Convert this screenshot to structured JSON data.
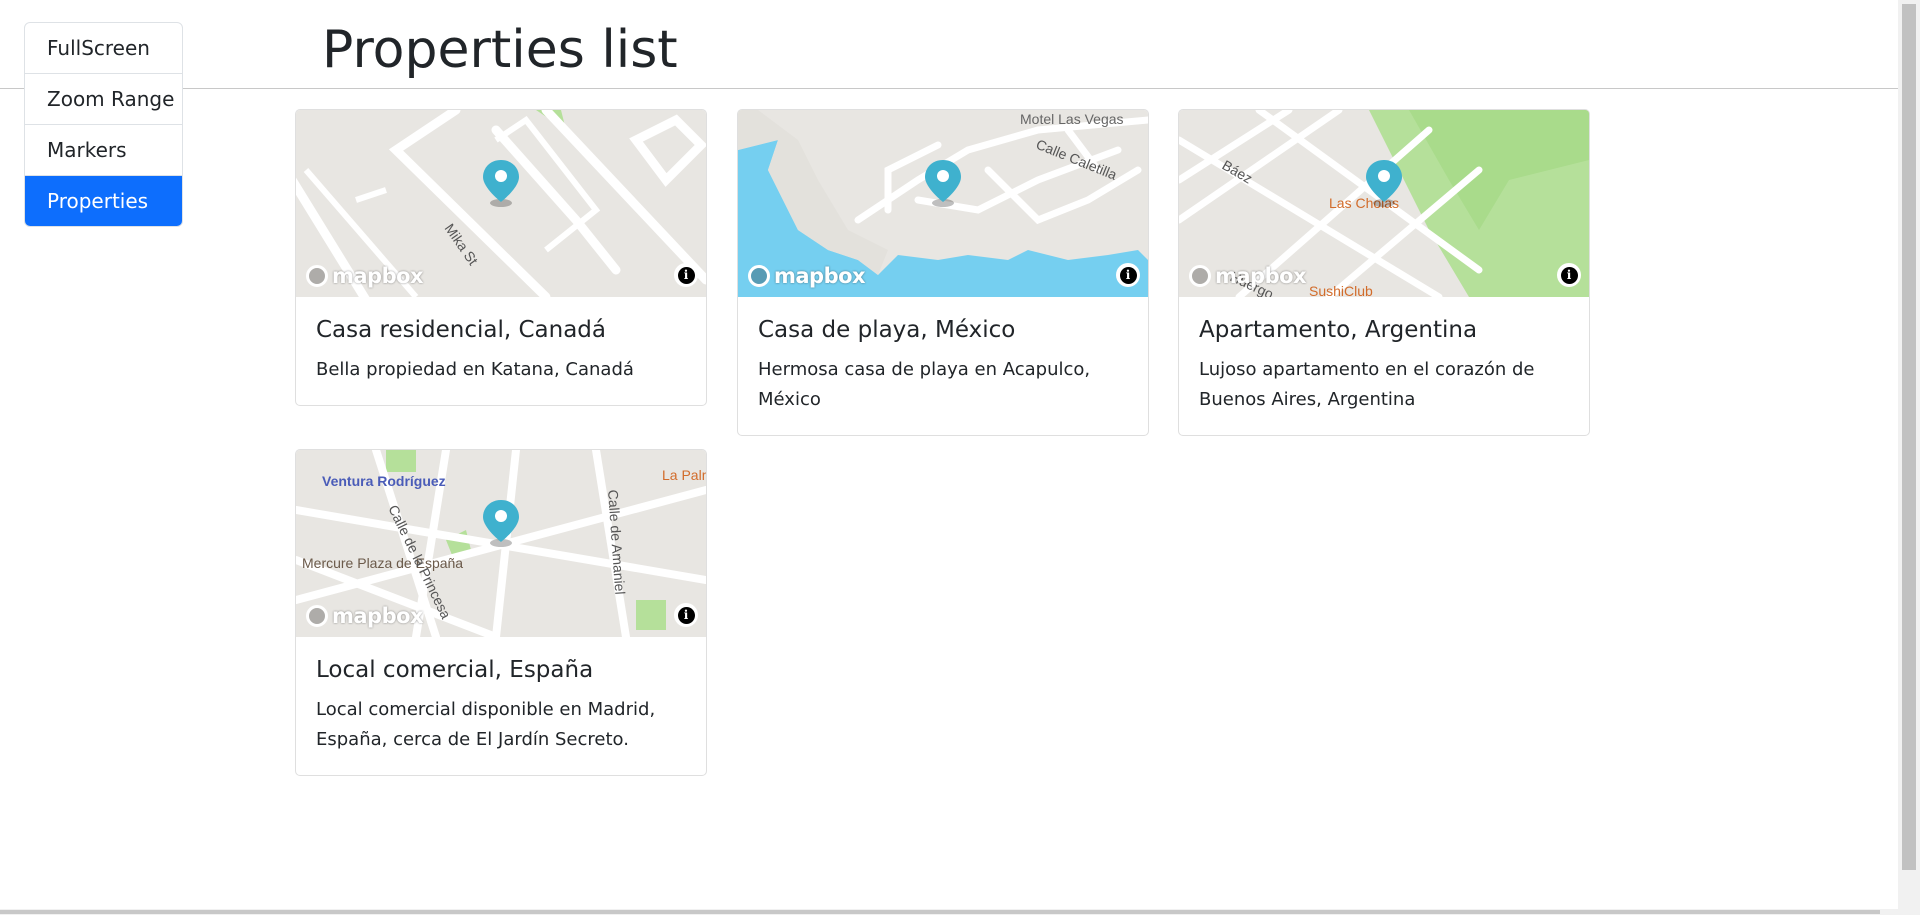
{
  "page": {
    "title": "Properties list"
  },
  "nav": {
    "items": [
      {
        "label": "FullScreen",
        "active": false
      },
      {
        "label": "Zoom Range",
        "active": false
      },
      {
        "label": "Markers",
        "active": false
      },
      {
        "label": "Properties",
        "active": true
      }
    ]
  },
  "map_common": {
    "logo_text": "mapbox",
    "info_glyph": "i"
  },
  "cards": [
    {
      "title": "Casa residencial, Canadá",
      "description": "Bella propiedad en Katana, Canadá",
      "map_labels": [
        "Mika St"
      ]
    },
    {
      "title": "Casa de playa, México",
      "description": "Hermosa casa de playa en Acapulco, México",
      "map_labels": [
        "Motel Las Vegas",
        "Calle Caletilla"
      ]
    },
    {
      "title": "Apartamento, Argentina",
      "description": "Lujoso apartamento en el corazón de Buenos Aires, Argentina",
      "map_labels": [
        "Báez",
        "Las Cholas",
        "SushiClub",
        "Huergo"
      ]
    },
    {
      "title": "Local comercial, España",
      "description": "Local comercial disponible en Madrid, España, cerca de El Jardín Secreto.",
      "map_labels": [
        "Ventura Rodríguez",
        "Mercure Plaza de España",
        "Calle de la Princesa",
        "Calle de Amaniel",
        "La Palm"
      ]
    }
  ],
  "colors": {
    "accent": "#0d6efd",
    "pin": "#3fb1ce",
    "water": "#75cff0",
    "park": "#b5e09a",
    "land": "#e8e6e2",
    "poi": "#d26c2b",
    "transit": "#4a5cb8"
  }
}
